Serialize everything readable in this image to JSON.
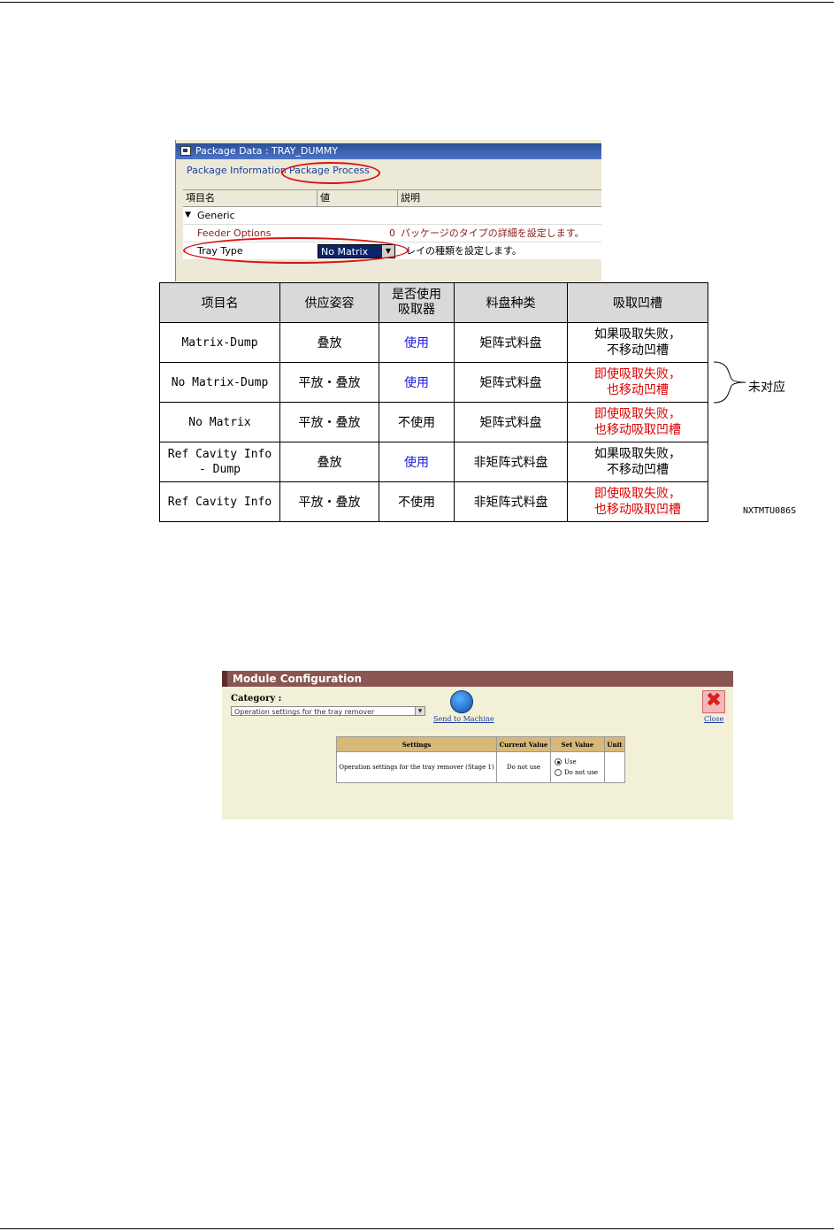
{
  "package_window": {
    "title": "Package Data : TRAY_DUMMY",
    "tabs": [
      "Package Information",
      "Package Process"
    ],
    "columns": [
      "項目名",
      "値",
      "説明"
    ],
    "group": "Generic",
    "rows": [
      {
        "name": "Feeder Options",
        "value": "0",
        "desc": "パッケージのタイプの詳細を設定します。"
      },
      {
        "name": "Tray Type",
        "value": "No Matrix",
        "desc": "レイの種類を設定します。"
      }
    ]
  },
  "table": {
    "headers": [
      "项目名",
      "供应姿容",
      "是否使用\n吸取器",
      "料盘种类",
      "吸取凹槽"
    ],
    "rows": [
      {
        "name": "Matrix-Dump",
        "supply": "叠放",
        "use": "使用",
        "tray": "矩阵式料盘",
        "groove": "如果吸取失败，\n不移动凹槽"
      },
      {
        "name": "No Matrix-Dump",
        "supply": "平放・叠放",
        "use": "使用",
        "tray": "矩阵式料盘",
        "groove": "即使吸取失败，\n也移动凹槽"
      },
      {
        "name": "No Matrix",
        "supply": "平放・叠放",
        "use": "不使用",
        "tray": "矩阵式料盘",
        "groove": "即使吸取失败，\n也移动吸取凹槽"
      },
      {
        "name": "Ref Cavity Info\n- Dump",
        "supply": "叠放",
        "use": "使用",
        "tray": "非矩阵式料盘",
        "groove": "如果吸取失败，\n不移动凹槽"
      },
      {
        "name": "Ref Cavity Info",
        "supply": "平放・叠放",
        "use": "不使用",
        "tray": "非矩阵式料盘",
        "groove": "即使吸取失败，\n也移动吸取凹槽"
      }
    ],
    "brace_label": "未对应",
    "figure_code": "NXTMTU086S"
  },
  "module_config": {
    "title": "Module Configuration",
    "category_label": "Category :",
    "category_value": "Operation settings for the tray remover",
    "send_label": "Send to Machine",
    "close_label": "Close",
    "columns": [
      "Settings",
      "Current Value",
      "Set Value",
      "Unit"
    ],
    "row": {
      "setting": "Operation settings for the tray remover (Stage 1)",
      "current": "Do not use",
      "options": [
        "Use",
        "Do not use"
      ],
      "selected": "Use",
      "unit": ""
    }
  },
  "colors": {
    "red": "#e00000",
    "blue": "#1a1ad6",
    "header_bg": "#d9d9d9"
  }
}
